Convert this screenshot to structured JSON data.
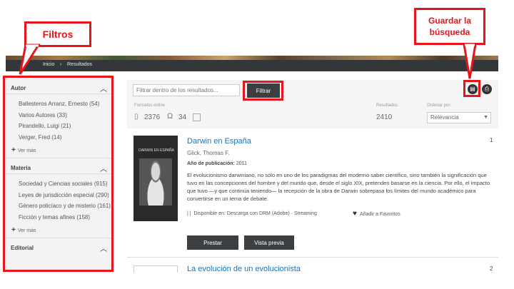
{
  "callouts": {
    "filters": "Filtros",
    "save_search": "Guardar la búsqueda"
  },
  "breadcrumb": {
    "home": "Inicio",
    "sep": "›",
    "current": "Resultados"
  },
  "sidebar": {
    "facets": [
      {
        "title": "Autor",
        "items": [
          "Ballesteros Arranz, Ernesto (54)",
          "Varios Autores (33)",
          "Pirandello, Luigi (21)",
          "Verger, Fred (14)"
        ],
        "more": "Ver más"
      },
      {
        "title": "Materia",
        "items": [
          "Sociedad y Ciencias sociales (915)",
          "Leyes de jurisdicción especial (290)",
          "Género policíaco y de misterio (161)",
          "Ficción y temas afines (158)"
        ],
        "more": "Ver más"
      },
      {
        "title": "Editorial",
        "items": [],
        "more": ""
      }
    ]
  },
  "toolbar": {
    "filter_placeholder": "Filtrar dentro de los resultados...",
    "filter_button": "Filtrar",
    "save_icon": "save-icon",
    "print_icon": "print-icon"
  },
  "stats": {
    "formats_label": "Formatos online",
    "ebooks_count": "2376",
    "audio_count": "34",
    "results_label": "Resultados",
    "results_count": "2410",
    "order_label": "Ordenar por:",
    "order_value": "Relevancia"
  },
  "results": [
    {
      "number": "1",
      "title": "Darwin en España",
      "cover_title": "DARWIN EN ESPAÑA",
      "author": "Glick, Thomas F.",
      "year_label": "Año de publicación:",
      "year": "2011",
      "description": "El evolucionismo darwiniano, no sólo en uno de los paradigmas del moderno saber científico, sino también la significación que tuvo en las concepciones del hombre y del mundo que, desde el siglo XIX, pretenden basarse en la ciencia. Por ello, el impacto que tuvo —y que continúa teniendo— la recepción de la obra de Darwin sobrepasa los límites del mundo académico para convertirse en un tema de debate.",
      "availability_label": "Disponible en:",
      "availability": "Descarga con DRM (Adobe) · Streaming",
      "favorite": "Añadir a Favoritos",
      "borrow": "Prestar",
      "preview": "Vista previa"
    },
    {
      "number": "2",
      "title": "La evolución de un evolucionista"
    }
  ],
  "colors": {
    "highlight": "#e8141b",
    "link": "#1a73b8",
    "dark": "#3b3f42"
  }
}
